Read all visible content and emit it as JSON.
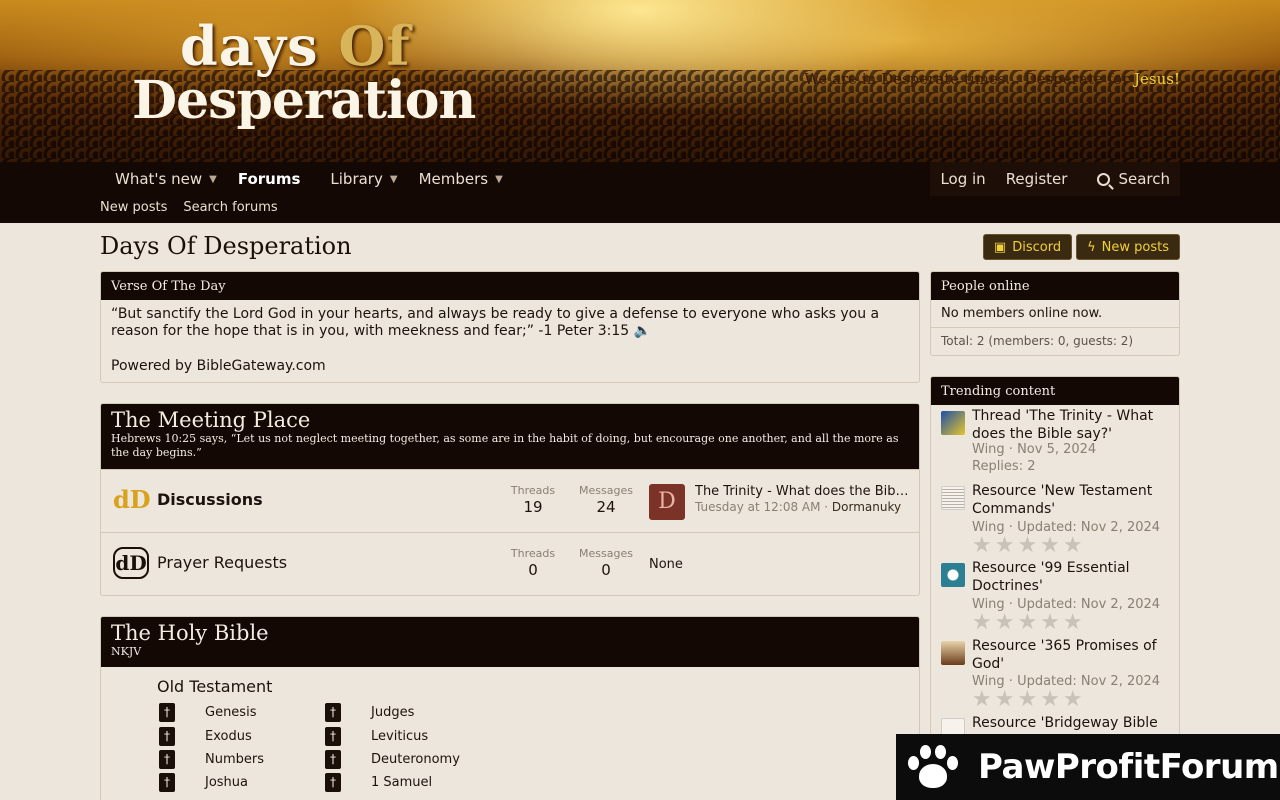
{
  "banner": {
    "logo_top": "days",
    "logo_of": "Of",
    "logo_main": "Desperation",
    "tagline_prefix": "We are in Desperate times... Desperate for ",
    "tagline_highlight": "Jesus!"
  },
  "nav": {
    "items": [
      "What's new",
      "Forums",
      "Library",
      "Members"
    ],
    "login": "Log in",
    "register": "Register",
    "search": "Search",
    "sub": [
      "New posts",
      "Search forums"
    ]
  },
  "page": {
    "title": "Days Of Desperation",
    "discord": "Discord",
    "new_posts": "New posts"
  },
  "verse": {
    "header": "Verse Of The Day",
    "text": "“But sanctify the Lord God in your hearts, and always be ready to give a defense to everyone who asks you a reason for the hope that is in you, with meekness and fear;” -1 Peter 3:15",
    "powered": "Powered by BibleGateway.com"
  },
  "meeting": {
    "title": "The Meeting Place",
    "desc": "Hebrews 10:25 says, “Let us not neglect meeting together, as some are in the habit of doing, but encourage one another, and all the more as the day begins.”",
    "nodes": [
      {
        "title": "Discussions",
        "threads_label": "Threads",
        "threads": "19",
        "messages_label": "Messages",
        "messages": "24",
        "latest_avatar": "D",
        "latest_title": "The Trinity - What does the Bible say?",
        "latest_time": "Tuesday at 12:08 AM",
        "latest_sep": " · ",
        "latest_user": "Dormanuky"
      },
      {
        "title": "Prayer Requests",
        "threads_label": "Threads",
        "threads": "0",
        "messages_label": "Messages",
        "messages": "0",
        "latest_none": "None"
      }
    ]
  },
  "bible": {
    "title": "The Holy Bible",
    "desc": "NKJV",
    "ot_title": "Old Testament",
    "books_col1": [
      "Genesis",
      "Exodus",
      "Numbers",
      "Joshua"
    ],
    "books_col2": [
      "Judges",
      "Leviticus",
      "Deuteronomy",
      "1 Samuel"
    ]
  },
  "online": {
    "header": "People online",
    "body": "No members online now.",
    "total": "Total: 2 (members: 0, guests: 2)"
  },
  "trending": {
    "header": "Trending content",
    "items": [
      {
        "title": "Thread 'The Trinity - What does the Bible say?'",
        "meta": "Wing · Nov 5, 2024",
        "extra": "Replies: 2"
      },
      {
        "title": "Resource 'New Testament Commands'",
        "meta": "Wing · Updated: Nov 2, 2024"
      },
      {
        "title": "Resource '99 Essential Doctrines'",
        "meta": "Wing · Updated: Nov 2, 2024"
      },
      {
        "title": "Resource '365 Promises of God'",
        "meta": "Wing · Updated: Nov 2, 2024"
      },
      {
        "title": "Resource 'Bridgeway Bible"
      }
    ],
    "stars": "★★★★★"
  },
  "watermark": {
    "text": "PawProfitForum"
  },
  "colors": {
    "nav_bg": "#140804",
    "accent_gold": "#f2d036",
    "page_bg": "#ece6dc"
  }
}
